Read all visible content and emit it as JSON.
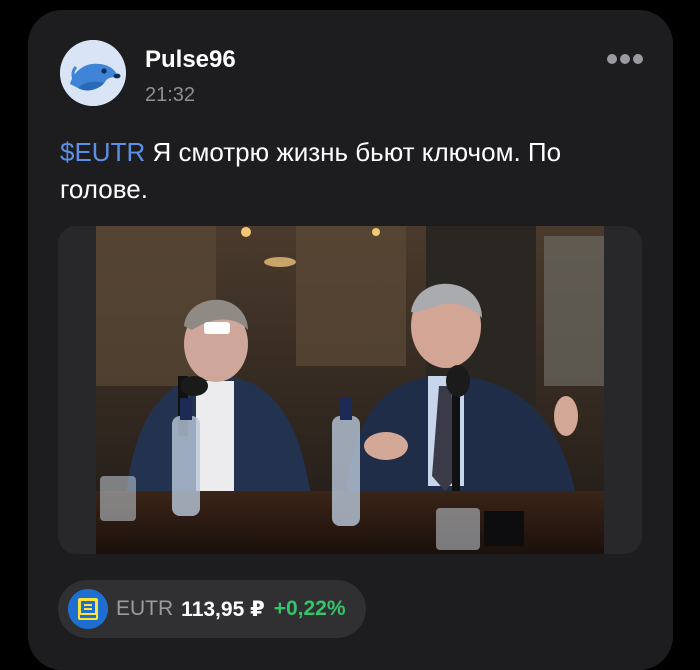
{
  "post": {
    "author": "Pulse96",
    "time": "21:32",
    "ticker_mention": "$EUTR",
    "text": " Я смотрю жизнь бьют ключом. По голове."
  },
  "instrument": {
    "ticker": "EUTR",
    "price": "113,95 ₽",
    "change": "+0,22%",
    "change_color": "#36c46b",
    "logo_icon": "eutr-logo-icon"
  },
  "colors": {
    "link": "#5d8fe6",
    "card_bg": "#1d1d1f"
  }
}
